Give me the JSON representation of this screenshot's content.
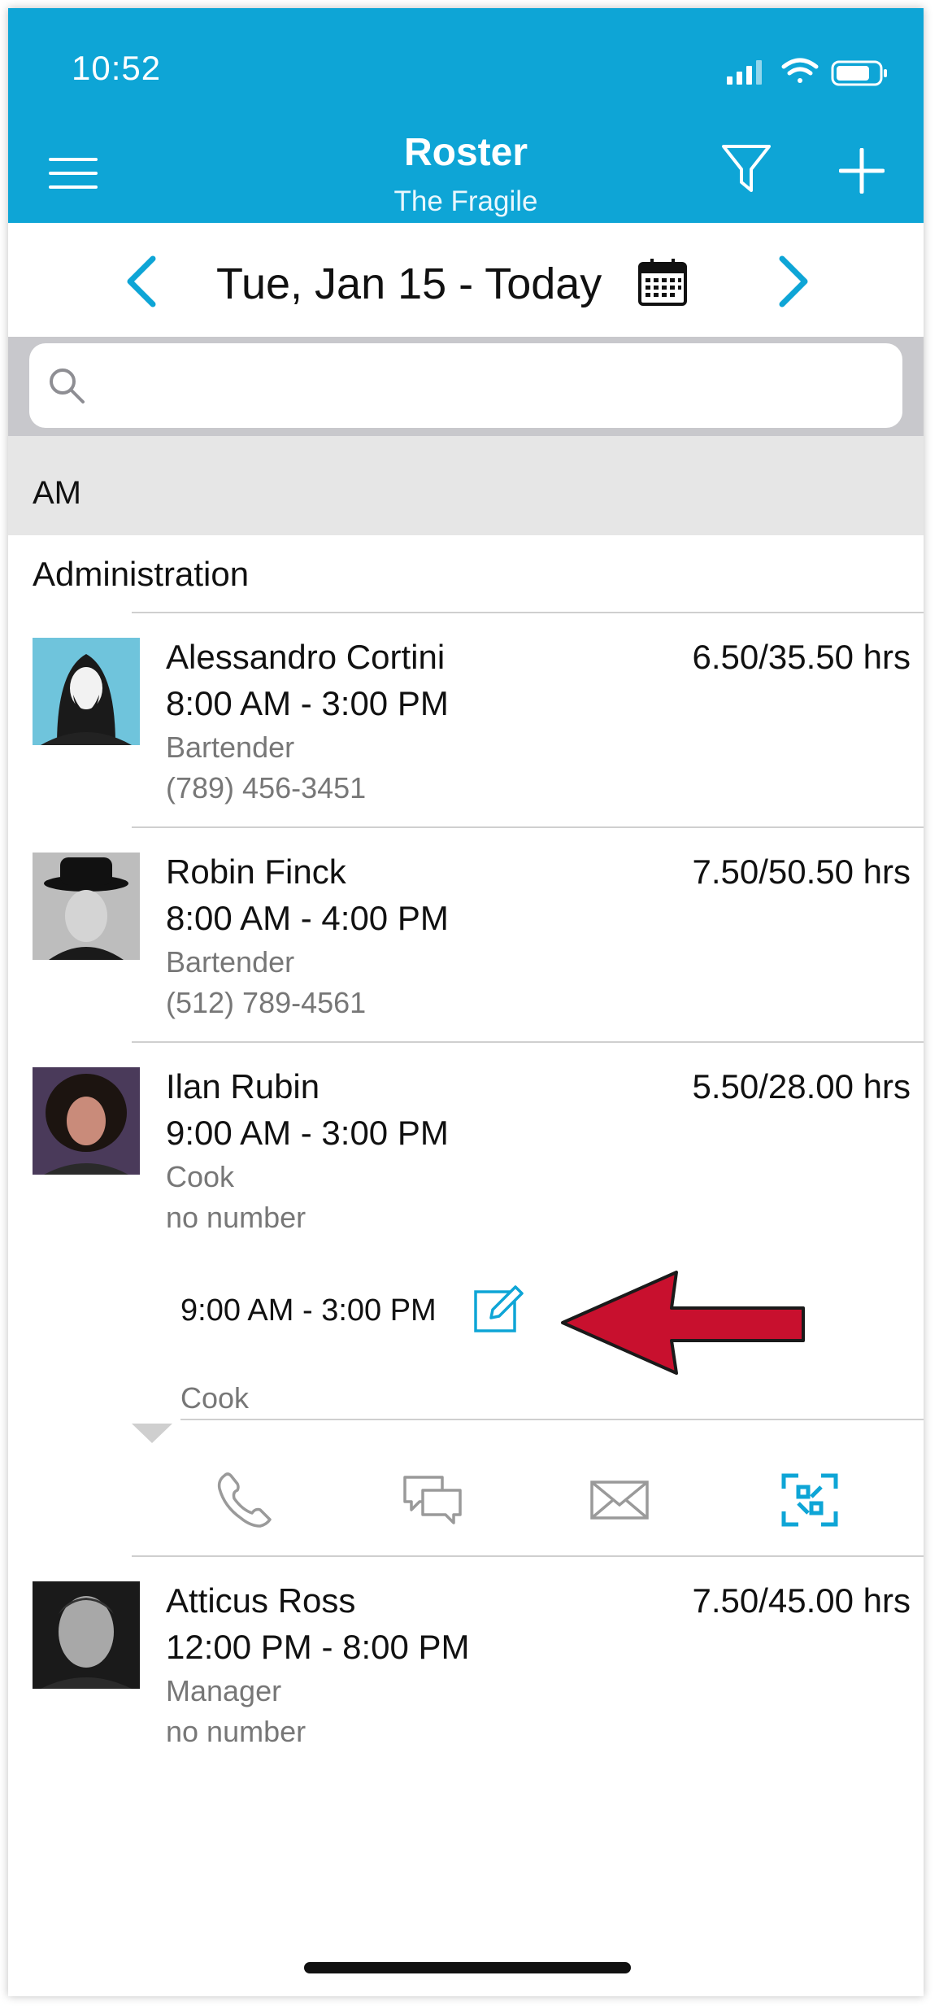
{
  "status_bar": {
    "time": "10:52"
  },
  "header": {
    "title": "Roster",
    "subtitle": "The Fragile",
    "accent_color": "#0ea5d6",
    "icons": [
      "hamburger-menu-icon",
      "filter-icon",
      "plus-icon"
    ]
  },
  "date_nav": {
    "label": "Tue, Jan 15 - Today",
    "icons": [
      "chevron-left-icon",
      "calendar-icon",
      "chevron-right-icon"
    ]
  },
  "search": {
    "placeholder": "",
    "value": ""
  },
  "section": {
    "label": "AM"
  },
  "group": {
    "label": "Administration"
  },
  "employees": [
    {
      "name": "Alessandro Cortini",
      "time": "8:00 AM - 3:00 PM",
      "role": "Bartender",
      "phone": "(789) 456-3451",
      "hours": "6.50/35.50 hrs"
    },
    {
      "name": "Robin Finck",
      "time": "8:00 AM - 4:00 PM",
      "role": "Bartender",
      "phone": "(512) 789-4561",
      "hours": "7.50/50.50 hrs"
    },
    {
      "name": "Ilan Rubin",
      "time": "9:00 AM - 3:00 PM",
      "role": "Cook",
      "phone": "no number",
      "hours": "5.50/28.00 hrs"
    },
    {
      "name": "Atticus Ross",
      "time": "12:00 PM - 8:00 PM",
      "role": "Manager",
      "phone": "no number",
      "hours": "7.50/45.00 hrs"
    }
  ],
  "expanded_shift": {
    "time": "9:00 AM - 3:00 PM",
    "role": "Cook",
    "actions": [
      "phone-icon",
      "chat-icon",
      "mail-icon",
      "qr-scan-icon"
    ]
  }
}
